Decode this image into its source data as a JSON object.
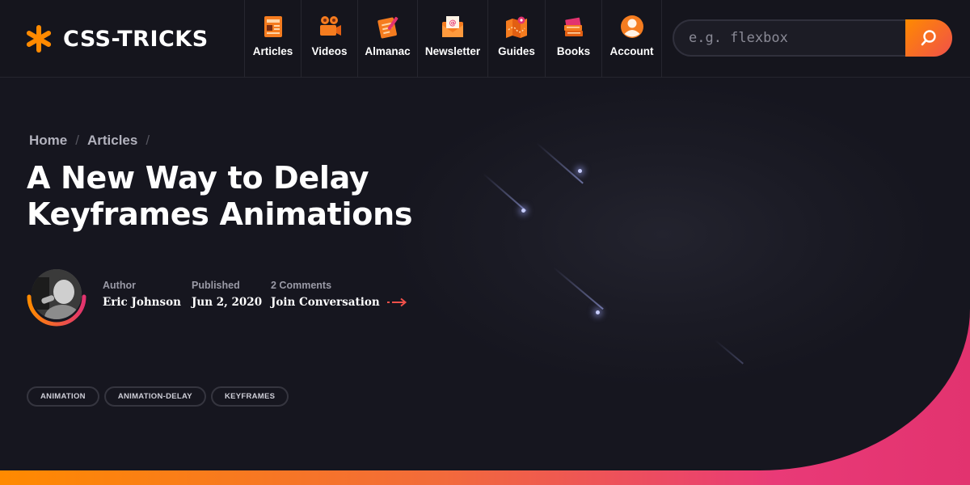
{
  "site": {
    "logo_text": "CSS-TRICKS",
    "accent_orange": "#ff8a00",
    "accent_pink": "#e2336f"
  },
  "nav": {
    "items": [
      {
        "label": "Articles",
        "icon": "newspaper-icon"
      },
      {
        "label": "Videos",
        "icon": "video-camera-icon"
      },
      {
        "label": "Almanac",
        "icon": "notepad-icon"
      },
      {
        "label": "Newsletter",
        "icon": "envelope-icon"
      },
      {
        "label": "Guides",
        "icon": "map-icon"
      },
      {
        "label": "Books",
        "icon": "books-icon"
      },
      {
        "label": "Account",
        "icon": "user-icon"
      }
    ]
  },
  "search": {
    "placeholder": "e.g. flexbox",
    "value": "",
    "button_icon": "search-icon"
  },
  "breadcrumb": {
    "home": "Home",
    "articles": "Articles",
    "separator": "/"
  },
  "article": {
    "title": "A New Way to Delay Keyframes Animations",
    "author_label": "Author",
    "author_name": "Eric Johnson",
    "published_label": "Published",
    "published_date": "Jun 2, 2020",
    "comments_label": "2 Comments",
    "comments_link": "Join Conversation"
  },
  "tags": [
    "ANIMATION",
    "ANIMATION-DELAY",
    "KEYFRAMES"
  ]
}
